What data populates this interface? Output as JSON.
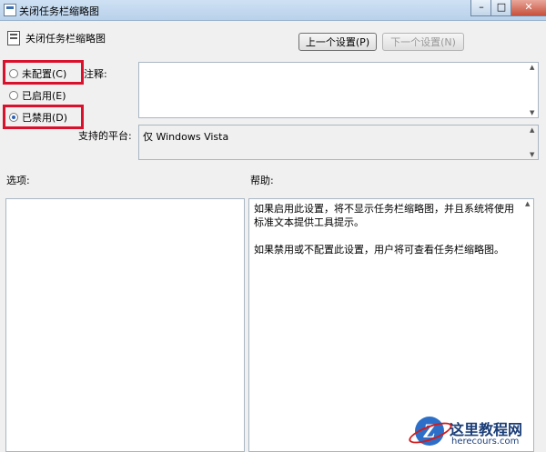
{
  "window": {
    "title": "关闭任务栏缩略图",
    "min_glyph": "–",
    "max_glyph": "□",
    "close_glyph": "✕"
  },
  "policy": {
    "title": "关闭任务栏缩略图"
  },
  "nav": {
    "prev_label": "上一个设置(P)",
    "next_label": "下一个设置(N)"
  },
  "options": [
    {
      "label": "未配置(C)",
      "checked": false
    },
    {
      "label": "已启用(E)",
      "checked": false
    },
    {
      "label": "已禁用(D)",
      "checked": true
    }
  ],
  "comment": {
    "label": "注释:",
    "value": ""
  },
  "platform": {
    "label": "支持的平台:",
    "value": "仅 Windows Vista"
  },
  "panels": {
    "options_label": "选项:",
    "help_label": "帮助:",
    "help_text": "如果启用此设置，将不显示任务栏缩略图，并且系统将使用标准文本提供工具提示。\n\n如果禁用或不配置此设置，用户将可查看任务栏缩略图。"
  },
  "watermark": {
    "logo_letter": "Z",
    "name": "这里教程网",
    "url": "herecours.com"
  },
  "colors": {
    "highlight": "#d9112c",
    "title_bar": "#b9d1ea"
  }
}
